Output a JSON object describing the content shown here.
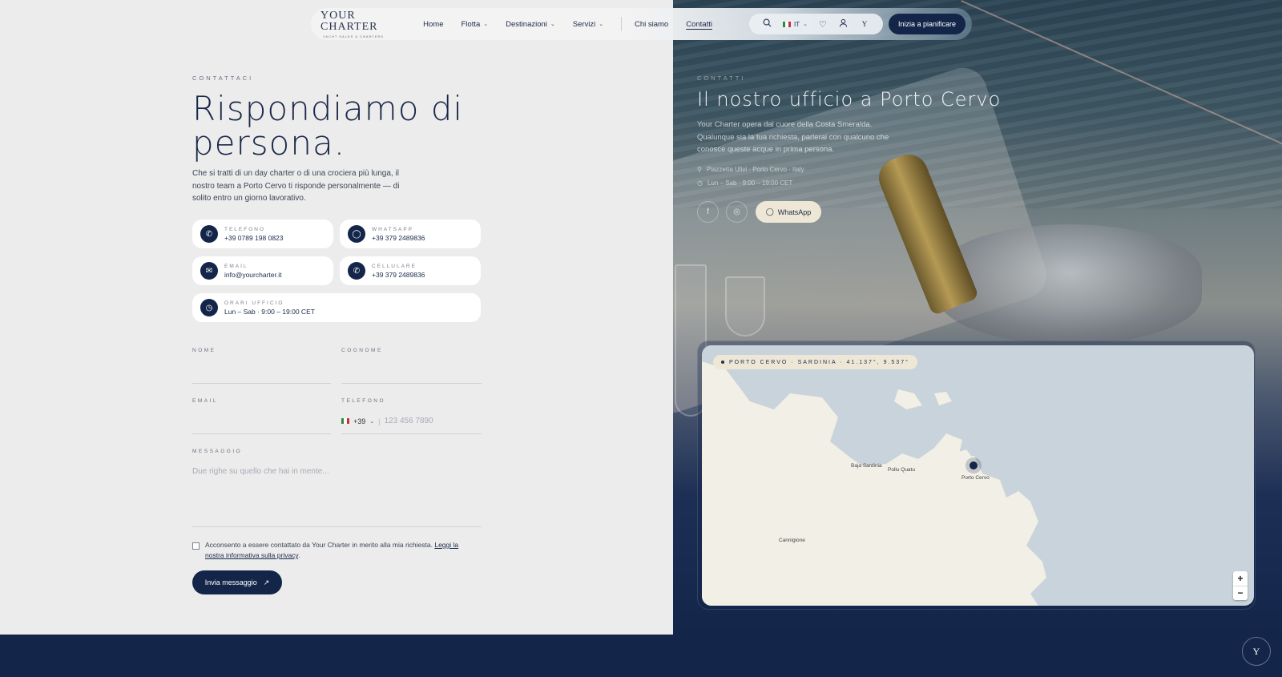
{
  "nav": {
    "logo_main": "YOUR CHARTER",
    "logo_sub": "YACHT SALES & CHARTERS",
    "items": [
      {
        "label": "Home",
        "dropdown": false
      },
      {
        "label": "Flotta",
        "dropdown": true
      },
      {
        "label": "Destinazioni",
        "dropdown": true
      },
      {
        "label": "Servizi",
        "dropdown": true
      }
    ],
    "items2": [
      {
        "label": "Chi siamo",
        "active": false
      },
      {
        "label": "Contatti",
        "active": true
      }
    ],
    "language": "IT",
    "monogram": "Y",
    "cta": "Inizia a pianificare"
  },
  "contact": {
    "eyebrow": "CONTATTACI",
    "title_line1": "Rispondiamo di",
    "title_line2": "persona.",
    "lead": "Che si tratti di un day charter o di una crociera più lunga, il nostro team a Porto Cervo ti risponde personalmente — di solito entro un giorno lavorativo.",
    "cards": [
      {
        "icon": "phone-icon",
        "label": "TELEFONO",
        "value": "+39 0789 198 0823"
      },
      {
        "icon": "chat-icon",
        "label": "WHATSAPP",
        "value": "+39 379 2489836"
      },
      {
        "icon": "mail-icon",
        "label": "EMAIL",
        "value": "info@yourcharter.it"
      },
      {
        "icon": "phone-icon",
        "label": "CELLULARE",
        "value": "+39 379 2489836"
      },
      {
        "icon": "clock-icon",
        "label": "ORARI UFFICIO",
        "value": "Lun – Sab · 9:00 – 19:00 CET"
      }
    ]
  },
  "form": {
    "nome_label": "NOME",
    "cognome_label": "COGNOME",
    "email_label": "EMAIL",
    "telefono_label": "TELEFONO",
    "country_code": "+39",
    "phone_placeholder": "123 456 7890",
    "messaggio_label": "MESSAGGIO",
    "message_placeholder": "Due righe su quello che hai in mente...",
    "consent_text": "Acconsento a essere contattato da Your Charter in merito alla mia richiesta.",
    "consent_link": "Leggi la nostra informativa sulla privacy",
    "submit": "Invia messaggio"
  },
  "office": {
    "eyebrow": "CONTATTI",
    "title": "Il nostro ufficio a Porto Cervo",
    "text": "Your Charter opera dal cuore della Costa Smeralda. Qualunque sia la tua richiesta, parlerai con qualcuno che conosce queste acque in prima persona.",
    "address": "Piazzetta Ulivi · Porto Cervo · Italy",
    "hours": "Lun – Sab · 9:00 – 19:00 CET",
    "whatsapp_label": "WhatsApp"
  },
  "map": {
    "tag": "PORTO CERVO · SARDINIA · 41.137°, 9.537°",
    "places": [
      "Baja Sardinia",
      "Pollu Quatu",
      "Porto Cervo",
      "Cannigione"
    ],
    "zoom_in": "+",
    "zoom_out": "−"
  },
  "fab_label": "Y",
  "colors": {
    "navy": "#14254a",
    "sand": "#efe7d6",
    "light_bg": "#ececec"
  }
}
